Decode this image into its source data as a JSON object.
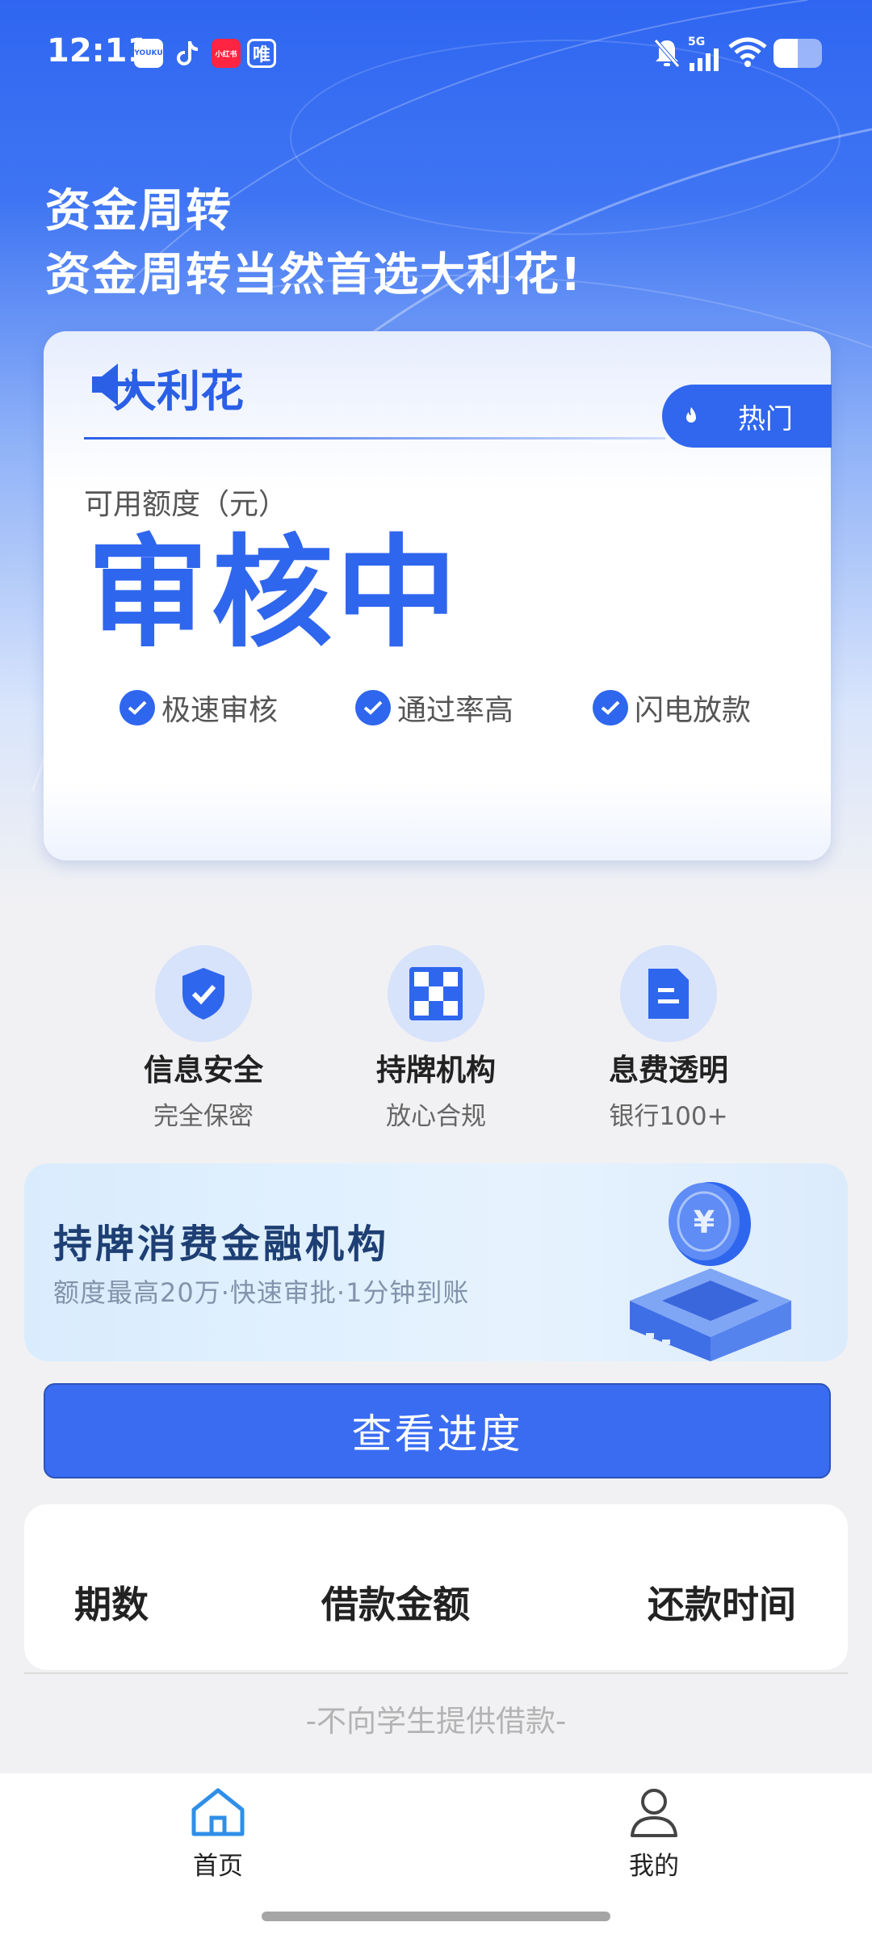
{
  "status_bar": {
    "time": "12:11",
    "apps": [
      "YOUKU",
      "tiktok-icon",
      "小红书",
      "唯"
    ],
    "network": "5G"
  },
  "hero": {
    "headline_1": "资金周转",
    "headline_2": "资金周转当然首选大利花!"
  },
  "card": {
    "brand": "大利花",
    "hot_badge": "热门",
    "quota_label": "可用额度（元）",
    "status_value": "审核中",
    "features": [
      "极速审核",
      "通过率高",
      "闪电放款"
    ]
  },
  "trust": [
    {
      "title": "信息安全",
      "subtitle": "完全保密",
      "icon": "shield-check-icon"
    },
    {
      "title": "持牌机构",
      "subtitle": "放心合规",
      "icon": "checker-grid-icon"
    },
    {
      "title": "息费透明",
      "subtitle": "银行100+",
      "icon": "document-icon"
    }
  ],
  "banner": {
    "title": "持牌消费金融机构",
    "subtitle": "额度最高20万·快速审批·1分钟到账",
    "coin_symbol": "¥"
  },
  "progress_button": "查看进度",
  "table": {
    "headers": [
      "期数",
      "借款金额",
      "还款时间"
    ]
  },
  "notice": "-不向学生提供借款-",
  "bottom_nav": [
    {
      "label": "首页",
      "active": true
    },
    {
      "label": "我的",
      "active": false
    }
  ],
  "colors": {
    "primary": "#2f66ee",
    "button": "#3a6cf2",
    "hero_top": "#2f66f1"
  }
}
